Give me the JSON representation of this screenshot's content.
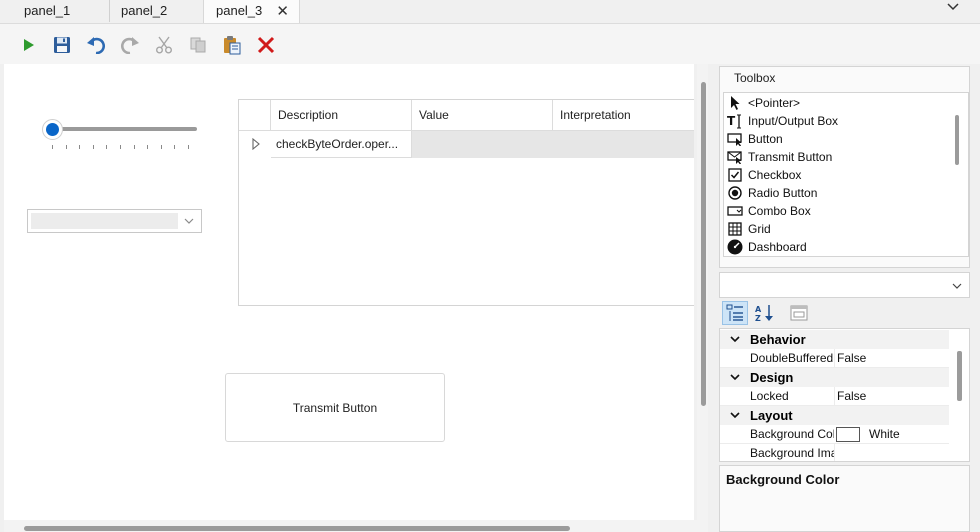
{
  "tabs": [
    {
      "label": "panel_1"
    },
    {
      "label": "panel_2"
    },
    {
      "label": "panel_3",
      "active": true
    }
  ],
  "toolbar": {
    "run": "run-icon",
    "save": "save-icon",
    "undo": "undo-icon",
    "redo": "redo-icon",
    "cut": "cut-icon",
    "copy": "copy-icon",
    "paste": "paste-icon",
    "delete": "delete-icon"
  },
  "canvas": {
    "slider": {
      "value_fraction": 0.0,
      "ticks": 11
    },
    "combo": {
      "value": ""
    },
    "grid": {
      "columns": [
        "Description",
        "Value",
        "Interpretation"
      ],
      "rows": [
        {
          "description": "checkByteOrder.oper...",
          "value": "",
          "interpretation": ""
        }
      ]
    },
    "transmit_button": {
      "label": "Transmit Button"
    }
  },
  "toolbox": {
    "title": "Toolbox",
    "items": [
      {
        "label": "<Pointer>",
        "icon": "pointer-icon"
      },
      {
        "label": "Input/Output Box",
        "icon": "text-cursor-icon"
      },
      {
        "label": "Button",
        "icon": "button-icon"
      },
      {
        "label": "Transmit Button",
        "icon": "transmit-button-icon"
      },
      {
        "label": "Checkbox",
        "icon": "checkbox-icon"
      },
      {
        "label": "Radio Button",
        "icon": "radio-button-icon"
      },
      {
        "label": "Combo Box",
        "icon": "combo-box-icon"
      },
      {
        "label": "Grid",
        "icon": "grid-icon"
      },
      {
        "label": "Dashboard",
        "icon": "dashboard-icon"
      }
    ]
  },
  "properties": {
    "object_selector": "",
    "categories": [
      {
        "name": "Behavior",
        "props": [
          {
            "name": "DoubleBuffered",
            "value": "False"
          }
        ]
      },
      {
        "name": "Design",
        "props": [
          {
            "name": "Locked",
            "value": "False"
          }
        ]
      },
      {
        "name": "Layout",
        "props": [
          {
            "name": "Background Color",
            "value": "White",
            "swatch": "#ffffff"
          },
          {
            "name": "Background Image",
            "value": ""
          }
        ]
      }
    ],
    "help_title": "Background Color"
  },
  "colors": {
    "accent": "#0a66c8",
    "run_green": "#2e9b2e",
    "delete_red": "#d11a1a",
    "selection": "#cde4f7"
  }
}
